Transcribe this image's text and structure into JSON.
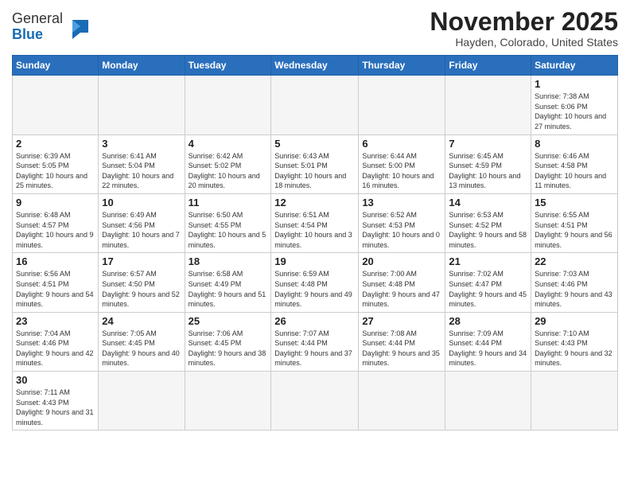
{
  "header": {
    "logo_general": "General",
    "logo_blue": "Blue",
    "month_title": "November 2025",
    "location": "Hayden, Colorado, United States"
  },
  "days_of_week": [
    "Sunday",
    "Monday",
    "Tuesday",
    "Wednesday",
    "Thursday",
    "Friday",
    "Saturday"
  ],
  "weeks": [
    [
      {
        "day": "",
        "info": ""
      },
      {
        "day": "",
        "info": ""
      },
      {
        "day": "",
        "info": ""
      },
      {
        "day": "",
        "info": ""
      },
      {
        "day": "",
        "info": ""
      },
      {
        "day": "",
        "info": ""
      },
      {
        "day": "1",
        "info": "Sunrise: 7:38 AM\nSunset: 6:06 PM\nDaylight: 10 hours and 27 minutes."
      }
    ],
    [
      {
        "day": "2",
        "info": "Sunrise: 6:39 AM\nSunset: 5:05 PM\nDaylight: 10 hours and 25 minutes."
      },
      {
        "day": "3",
        "info": "Sunrise: 6:41 AM\nSunset: 5:04 PM\nDaylight: 10 hours and 22 minutes."
      },
      {
        "day": "4",
        "info": "Sunrise: 6:42 AM\nSunset: 5:02 PM\nDaylight: 10 hours and 20 minutes."
      },
      {
        "day": "5",
        "info": "Sunrise: 6:43 AM\nSunset: 5:01 PM\nDaylight: 10 hours and 18 minutes."
      },
      {
        "day": "6",
        "info": "Sunrise: 6:44 AM\nSunset: 5:00 PM\nDaylight: 10 hours and 16 minutes."
      },
      {
        "day": "7",
        "info": "Sunrise: 6:45 AM\nSunset: 4:59 PM\nDaylight: 10 hours and 13 minutes."
      },
      {
        "day": "8",
        "info": "Sunrise: 6:46 AM\nSunset: 4:58 PM\nDaylight: 10 hours and 11 minutes."
      }
    ],
    [
      {
        "day": "9",
        "info": "Sunrise: 6:48 AM\nSunset: 4:57 PM\nDaylight: 10 hours and 9 minutes."
      },
      {
        "day": "10",
        "info": "Sunrise: 6:49 AM\nSunset: 4:56 PM\nDaylight: 10 hours and 7 minutes."
      },
      {
        "day": "11",
        "info": "Sunrise: 6:50 AM\nSunset: 4:55 PM\nDaylight: 10 hours and 5 minutes."
      },
      {
        "day": "12",
        "info": "Sunrise: 6:51 AM\nSunset: 4:54 PM\nDaylight: 10 hours and 3 minutes."
      },
      {
        "day": "13",
        "info": "Sunrise: 6:52 AM\nSunset: 4:53 PM\nDaylight: 10 hours and 0 minutes."
      },
      {
        "day": "14",
        "info": "Sunrise: 6:53 AM\nSunset: 4:52 PM\nDaylight: 9 hours and 58 minutes."
      },
      {
        "day": "15",
        "info": "Sunrise: 6:55 AM\nSunset: 4:51 PM\nDaylight: 9 hours and 56 minutes."
      }
    ],
    [
      {
        "day": "16",
        "info": "Sunrise: 6:56 AM\nSunset: 4:51 PM\nDaylight: 9 hours and 54 minutes."
      },
      {
        "day": "17",
        "info": "Sunrise: 6:57 AM\nSunset: 4:50 PM\nDaylight: 9 hours and 52 minutes."
      },
      {
        "day": "18",
        "info": "Sunrise: 6:58 AM\nSunset: 4:49 PM\nDaylight: 9 hours and 51 minutes."
      },
      {
        "day": "19",
        "info": "Sunrise: 6:59 AM\nSunset: 4:48 PM\nDaylight: 9 hours and 49 minutes."
      },
      {
        "day": "20",
        "info": "Sunrise: 7:00 AM\nSunset: 4:48 PM\nDaylight: 9 hours and 47 minutes."
      },
      {
        "day": "21",
        "info": "Sunrise: 7:02 AM\nSunset: 4:47 PM\nDaylight: 9 hours and 45 minutes."
      },
      {
        "day": "22",
        "info": "Sunrise: 7:03 AM\nSunset: 4:46 PM\nDaylight: 9 hours and 43 minutes."
      }
    ],
    [
      {
        "day": "23",
        "info": "Sunrise: 7:04 AM\nSunset: 4:46 PM\nDaylight: 9 hours and 42 minutes."
      },
      {
        "day": "24",
        "info": "Sunrise: 7:05 AM\nSunset: 4:45 PM\nDaylight: 9 hours and 40 minutes."
      },
      {
        "day": "25",
        "info": "Sunrise: 7:06 AM\nSunset: 4:45 PM\nDaylight: 9 hours and 38 minutes."
      },
      {
        "day": "26",
        "info": "Sunrise: 7:07 AM\nSunset: 4:44 PM\nDaylight: 9 hours and 37 minutes."
      },
      {
        "day": "27",
        "info": "Sunrise: 7:08 AM\nSunset: 4:44 PM\nDaylight: 9 hours and 35 minutes."
      },
      {
        "day": "28",
        "info": "Sunrise: 7:09 AM\nSunset: 4:44 PM\nDaylight: 9 hours and 34 minutes."
      },
      {
        "day": "29",
        "info": "Sunrise: 7:10 AM\nSunset: 4:43 PM\nDaylight: 9 hours and 32 minutes."
      }
    ],
    [
      {
        "day": "30",
        "info": "Sunrise: 7:11 AM\nSunset: 4:43 PM\nDaylight: 9 hours and 31 minutes."
      },
      {
        "day": "",
        "info": ""
      },
      {
        "day": "",
        "info": ""
      },
      {
        "day": "",
        "info": ""
      },
      {
        "day": "",
        "info": ""
      },
      {
        "day": "",
        "info": ""
      },
      {
        "day": "",
        "info": ""
      }
    ]
  ]
}
